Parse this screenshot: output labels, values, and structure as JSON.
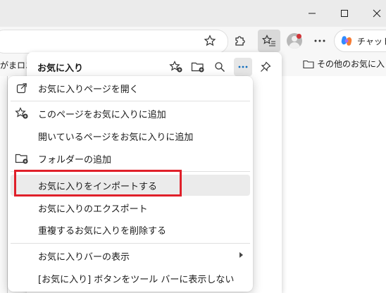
{
  "toolbar": {
    "copilot_label": "チャット"
  },
  "bookmarks_bar": {
    "left_fragment": "がまロエ",
    "other_favorites": "その他のお気に入"
  },
  "favorites_pane": {
    "title": "お気に入り"
  },
  "menu": {
    "items": [
      {
        "label": "お気に入りページを開く",
        "icon": "open-external-icon"
      },
      {
        "label": "このページをお気に入りに追加",
        "icon": "star-add-icon"
      },
      {
        "label": "開いているページをお気に入りに追加",
        "icon": ""
      },
      {
        "label": "フォルダーの追加",
        "icon": "folder-add-icon"
      },
      {
        "label": "お気に入りをインポートする",
        "icon": ""
      },
      {
        "label": "お気に入りのエクスポート",
        "icon": ""
      },
      {
        "label": "重複するお気に入りを削除する",
        "icon": ""
      },
      {
        "label": "お気に入りバーの表示",
        "icon": ""
      },
      {
        "label": "[お気に入り] ボタンをツール バーに表示しない",
        "icon": ""
      }
    ]
  },
  "colors": {
    "highlight": "#ebebeb",
    "annotation_red": "#e0202a",
    "accent_blue": "#0f6cbd"
  }
}
